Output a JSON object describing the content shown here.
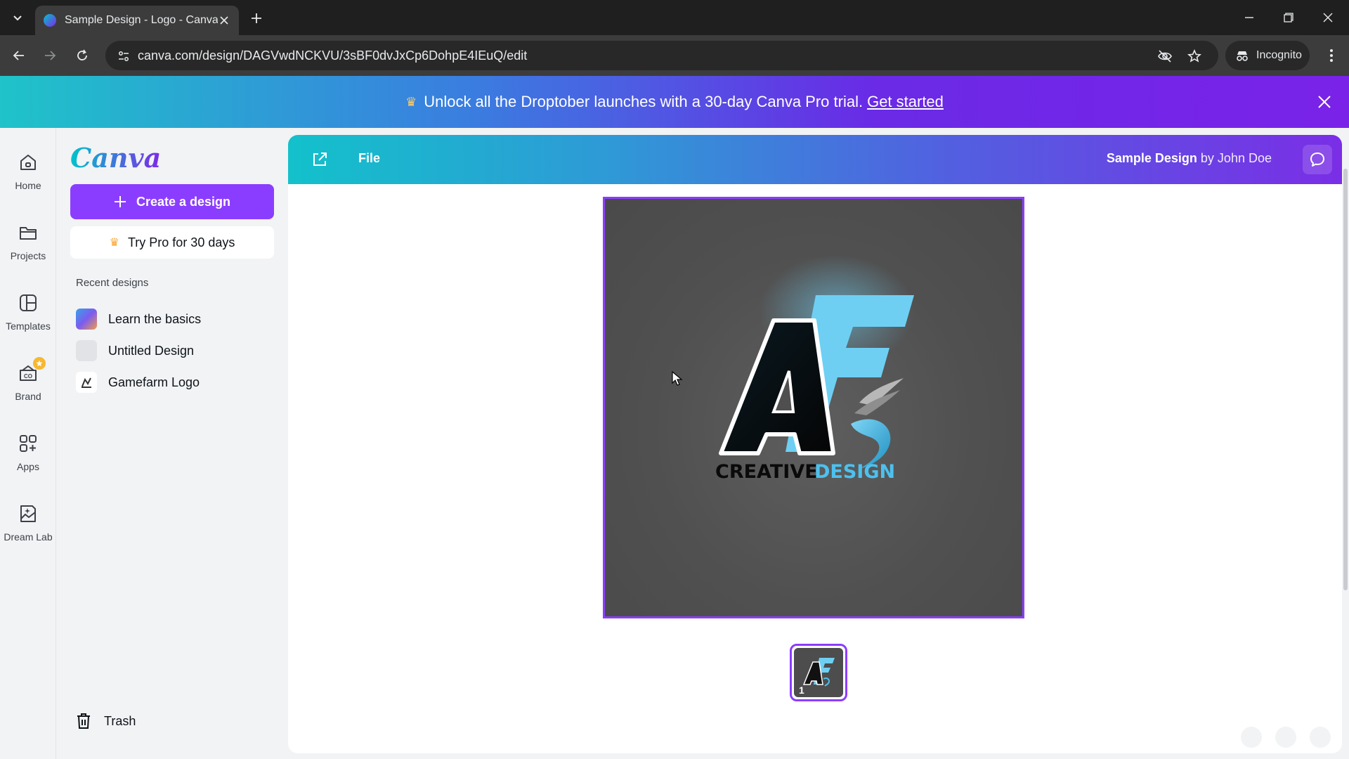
{
  "browser": {
    "tab_title": "Sample Design - Logo - Canva",
    "url": "canva.com/design/DAGVwdNCKVU/3sBF0dvJxCp6DohpE4IEuQ/edit",
    "incognito_label": "Incognito"
  },
  "banner": {
    "text": "Unlock all the Droptober launches with a 30-day Canva Pro trial.",
    "link": "Get started"
  },
  "rail": {
    "items": [
      {
        "label": "Home",
        "icon": "home-icon"
      },
      {
        "label": "Projects",
        "icon": "folder-icon"
      },
      {
        "label": "Templates",
        "icon": "templates-icon"
      },
      {
        "label": "Brand",
        "icon": "brand-icon"
      },
      {
        "label": "Apps",
        "icon": "apps-icon"
      },
      {
        "label": "Dream Lab",
        "icon": "dream-lab-icon"
      }
    ]
  },
  "sidebar": {
    "logo": "Canva",
    "create_label": "Create a design",
    "pro_label": "Try Pro for 30 days",
    "recent_title": "Recent designs",
    "recent": [
      {
        "label": "Learn the basics"
      },
      {
        "label": "Untitled Design"
      },
      {
        "label": "Gamefarm Logo"
      }
    ],
    "trash_label": "Trash"
  },
  "editor": {
    "file_label": "File",
    "design_name": "Sample Design",
    "by_text": "by John Doe",
    "page_number": "1"
  },
  "artwork": {
    "text_left": "CREATIVE",
    "text_right": "DESIGN"
  },
  "colors": {
    "accent": "#8b3dff",
    "logo_blue": "#6ecff3",
    "canvas_bg": "#505050"
  }
}
